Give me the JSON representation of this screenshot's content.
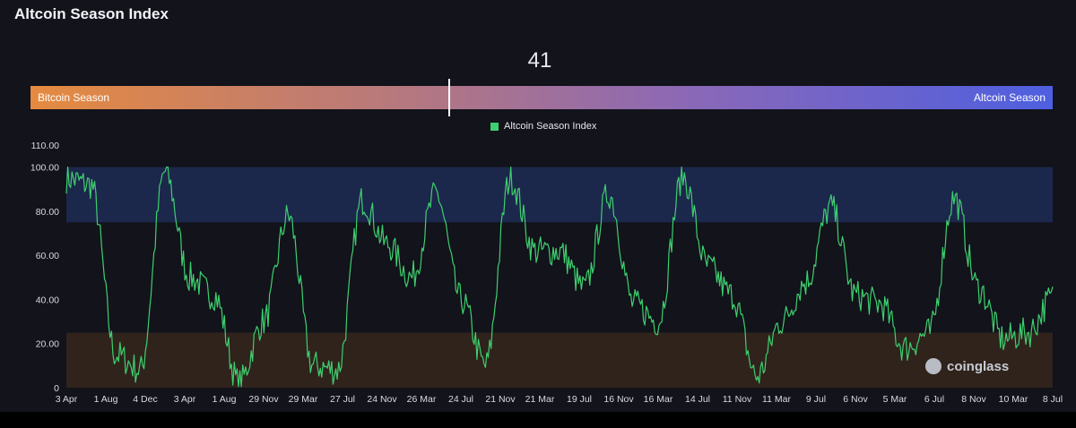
{
  "title": "Altcoin Season Index",
  "gauge": {
    "value": 41,
    "value_label": "41",
    "left_label": "Bitcoin Season",
    "right_label": "Altcoin Season",
    "max": 100
  },
  "legend": {
    "label": "Altcoin Season Index",
    "color": "#3ecf6e"
  },
  "watermark": "coinglass",
  "colors": {
    "line": "#3ecf6e",
    "altcoin_zone": "#1e2a52",
    "bitcoin_zone": "#33261d",
    "background": "#12131b"
  },
  "chart_data": {
    "type": "line",
    "x": [
      "3 Apr",
      "1 Aug",
      "4 Dec",
      "3 Apr",
      "1 Aug",
      "29 Nov",
      "29 Mar",
      "27 Jul",
      "24 Nov",
      "26 Mar",
      "24 Jul",
      "21 Nov",
      "21 Mar",
      "19 Jul",
      "16 Nov",
      "16 Mar",
      "14 Jul",
      "11 Nov",
      "11 Mar",
      "9 Jul",
      "6 Nov",
      "5 Mar",
      "6 Jul",
      "8 Nov",
      "10 Mar",
      "8 Jul"
    ],
    "series": [
      {
        "name": "Altcoin Season Index",
        "values": [
          95,
          92,
          15,
          8,
          98,
          50,
          42,
          2,
          30,
          78,
          10,
          8,
          85,
          65,
          50,
          88,
          40,
          10,
          95,
          62,
          62,
          45,
          88,
          38,
          30,
          96,
          55,
          42,
          5,
          30,
          48,
          82,
          42,
          38,
          18,
          25,
          86,
          45,
          22,
          25,
          41
        ]
      }
    ],
    "yticks": [
      "0",
      "20.00",
      "40.00",
      "60.00",
      "80.00",
      "100.00",
      "110.00"
    ],
    "ylim": [
      0,
      110
    ],
    "zones": {
      "altcoin_season_min": 75,
      "bitcoin_season_max": 25
    },
    "grid": false,
    "legend_position": "top-center"
  }
}
